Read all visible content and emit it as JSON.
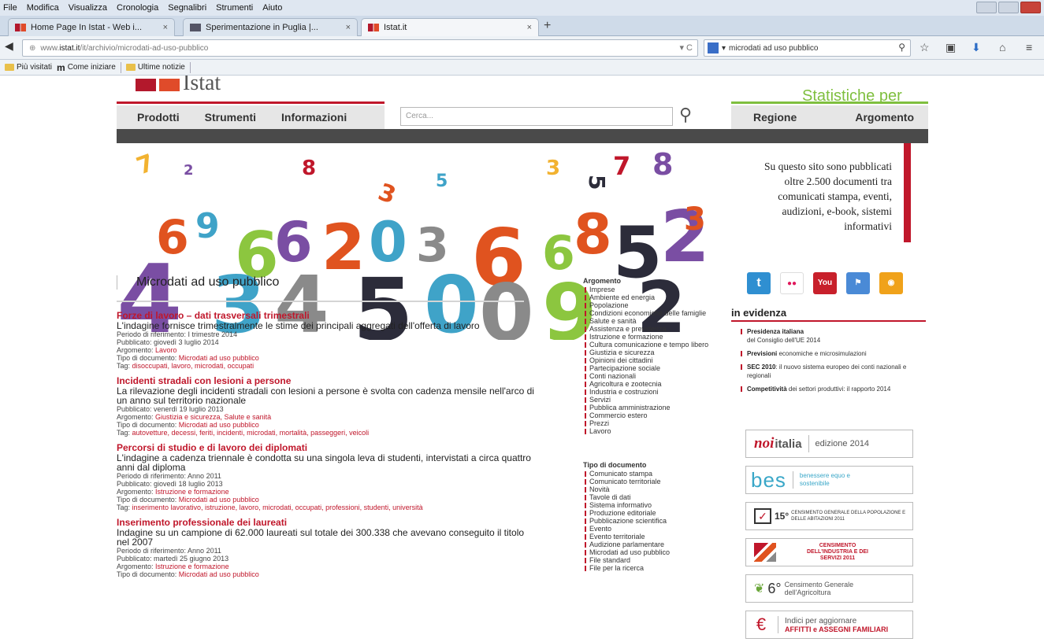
{
  "browser": {
    "menu": [
      "File",
      "Modifica",
      "Visualizza",
      "Cronologia",
      "Segnalibri",
      "Strumenti",
      "Aiuto"
    ],
    "tabs": [
      {
        "label": "Home Page In Istat - Web i...",
        "close": "×"
      },
      {
        "label": "Sperimentazione in Puglia |...",
        "close": "×"
      },
      {
        "label": "Istat.it",
        "close": "×"
      }
    ],
    "new_tab": "+",
    "url_prefix": "www.",
    "url_host": "istat.it",
    "url_path": "/it/archivio/microdati-ad-uso-pubblico",
    "search_value": "microdati ad uso pubblico",
    "bookmarks": [
      "Più visitati",
      "Come iniziare",
      "Ultime notizie"
    ]
  },
  "site": {
    "logo_text": "Istat",
    "tagline": "Statistiche per",
    "nav": [
      "Prodotti",
      "Strumenti",
      "Informazioni"
    ],
    "search_placeholder": "Cerca...",
    "side_nav": [
      "Regione",
      "Argomento"
    ],
    "info_text": "Su questo sito sono pubblicati oltre 2.500 documenti tra comunicati stampa, eventi, audizioni, e-book, sistemi informativi"
  },
  "main": {
    "title": "Microdati ad uso pubblico",
    "entries": [
      {
        "title": "Forze di lavoro – dati trasversali trimestrali",
        "desc": "L'indagine fornisce trimestralmente le stime dei principali aggregati dell'offerta di lavoro",
        "lines": [
          {
            "label": "Periodo di riferimento: ",
            "value": "I trimestre 2014",
            "link": false
          },
          {
            "label": "Pubblicato: ",
            "value": "giovedì 3 luglio 2014",
            "link": false
          },
          {
            "label": "Argomento: ",
            "value": "Lavoro",
            "link": true
          },
          {
            "label": "Tipo di documento: ",
            "value": "Microdati ad uso pubblico",
            "link": true
          },
          {
            "label": "Tag: ",
            "value": "disoccupati, lavoro, microdati, occupati",
            "link": true
          }
        ]
      },
      {
        "title": "Incidenti stradali con lesioni a persone",
        "desc": "La rilevazione degli incidenti stradali con lesioni a persone è svolta con cadenza mensile nell'arco di un anno sul territorio nazionale",
        "lines": [
          {
            "label": "Pubblicato: ",
            "value": "venerdì 19 luglio 2013",
            "link": false
          },
          {
            "label": "Argomento: ",
            "value": "Giustizia e sicurezza, Salute e sanità",
            "link": true
          },
          {
            "label": "Tipo di documento: ",
            "value": "Microdati ad uso pubblico",
            "link": true
          },
          {
            "label": "Tag: ",
            "value": "autovetture, decessi, feriti, incidenti, microdati, mortalità, passeggeri, veicoli",
            "link": true
          }
        ]
      },
      {
        "title": "Percorsi di studio e di lavoro dei diplomati",
        "desc": "L'indagine a cadenza triennale è condotta su una singola leva di studenti, intervistati a circa quattro anni dal diploma",
        "lines": [
          {
            "label": "Periodo di riferimento: ",
            "value": "Anno 2011",
            "link": false
          },
          {
            "label": "Pubblicato: ",
            "value": "giovedì 18 luglio 2013",
            "link": false
          },
          {
            "label": "Argomento: ",
            "value": "Istruzione e formazione",
            "link": true
          },
          {
            "label": "Tipo di documento: ",
            "value": "Microdati ad uso pubblico",
            "link": true
          },
          {
            "label": "Tag: ",
            "value": "inserimento lavorativo, istruzione, lavoro, microdati, occupati, professioni, studenti, università",
            "link": true
          }
        ]
      },
      {
        "title": "Inserimento professionale dei laureati",
        "desc": "Indagine su un campione di 62.000 laureati sul totale dei 300.338 che avevano conseguito il titolo nel 2007",
        "lines": [
          {
            "label": "Periodo di riferimento: ",
            "value": "Anno 2011",
            "link": false
          },
          {
            "label": "Pubblicato: ",
            "value": "martedì 25 giugno 2013",
            "link": false
          },
          {
            "label": "Argomento: ",
            "value": "Istruzione e formazione",
            "link": true
          },
          {
            "label": "Tipo di documento: ",
            "value": "Microdati ad uso pubblico",
            "link": true
          }
        ]
      }
    ]
  },
  "facets": {
    "argomento_title": "Argomento",
    "argomento": [
      "Imprese",
      "Ambiente ed energia",
      "Popolazione",
      "Condizioni economiche delle famiglie",
      "Salute e sanità",
      "Assistenza e previdenza",
      "Istruzione e formazione",
      "Cultura comunicazione e tempo libero",
      "Giustizia e sicurezza",
      "Opinioni dei cittadini",
      "Partecipazione sociale",
      "Conti nazionali",
      "Agricoltura e zootecnia",
      "Industria e costruzioni",
      "Servizi",
      "Pubblica amministrazione",
      "Commercio estero",
      "Prezzi",
      "Lavoro"
    ],
    "tipo_title": "Tipo di documento",
    "tipo": [
      "Comunicato stampa",
      "Comunicato territoriale",
      "Novità",
      "Tavole di dati",
      "Sistema informativo",
      "Produzione editoriale",
      "Pubblicazione scientifica",
      "Evento",
      "Evento territoriale",
      "Audizione parlamentare",
      "Microdati ad uso pubblico",
      "File standard",
      "File per la ricerca"
    ]
  },
  "evidenza": {
    "title": "in evidenza",
    "items": [
      {
        "bold": "Presidenza italiana",
        "text": "del Consiglio dell'UE 2014"
      },
      {
        "bold": "Previsioni",
        "text": "economiche e microsimulazioni"
      },
      {
        "bold": "SEC 2010",
        "text": ": il nuovo sistema europeo dei conti nazionali e regionali"
      },
      {
        "bold": "Competitività",
        "text": "dei settori produttivi: il rapporto 2014"
      }
    ]
  },
  "promos": {
    "noi_brand": "noi",
    "noi_italia": "italia",
    "noi_edition": "edizione 2014",
    "bes_logo": "bes",
    "bes_text": "benessere equo e sostenibile",
    "cens15_num": "15°",
    "cens15_text": "CENSIMENTO GENERALE DELLA POPOLAZIONE E DELLE ABITAZIONI 2011",
    "cens_ind": "CENSIMENTO DELL'INDUSTRIA E DEI SERVIZI 2011",
    "cens6_num": "6°",
    "cens6_text": "Censimento Generale dell'Agricoltura",
    "affitti_line1": "Indici per aggiornare",
    "affitti_line2": "AFFITTI e ASSEGNI FAMILIARI",
    "euro_symbol": "€"
  },
  "social": [
    {
      "name": "twitter",
      "glyph": "t",
      "color": "#2f8fd1"
    },
    {
      "name": "flickr",
      "glyph": "●●",
      "color": "#3f7fc8"
    },
    {
      "name": "youtube",
      "glyph": "You",
      "color": "#c8202b"
    },
    {
      "name": "community",
      "glyph": "⚑",
      "color": "#4a8ad6"
    },
    {
      "name": "rss",
      "glyph": "◉",
      "color": "#f0a21a"
    }
  ],
  "banner_colors": {
    "purple": "#7a4ea3",
    "orange": "#e0531f",
    "green": "#8cc63f",
    "blue": "#3fa3c8",
    "grey": "#8a8a8a",
    "dark": "#2c2c3a",
    "yellow": "#f2b230",
    "red": "#c0172b"
  }
}
